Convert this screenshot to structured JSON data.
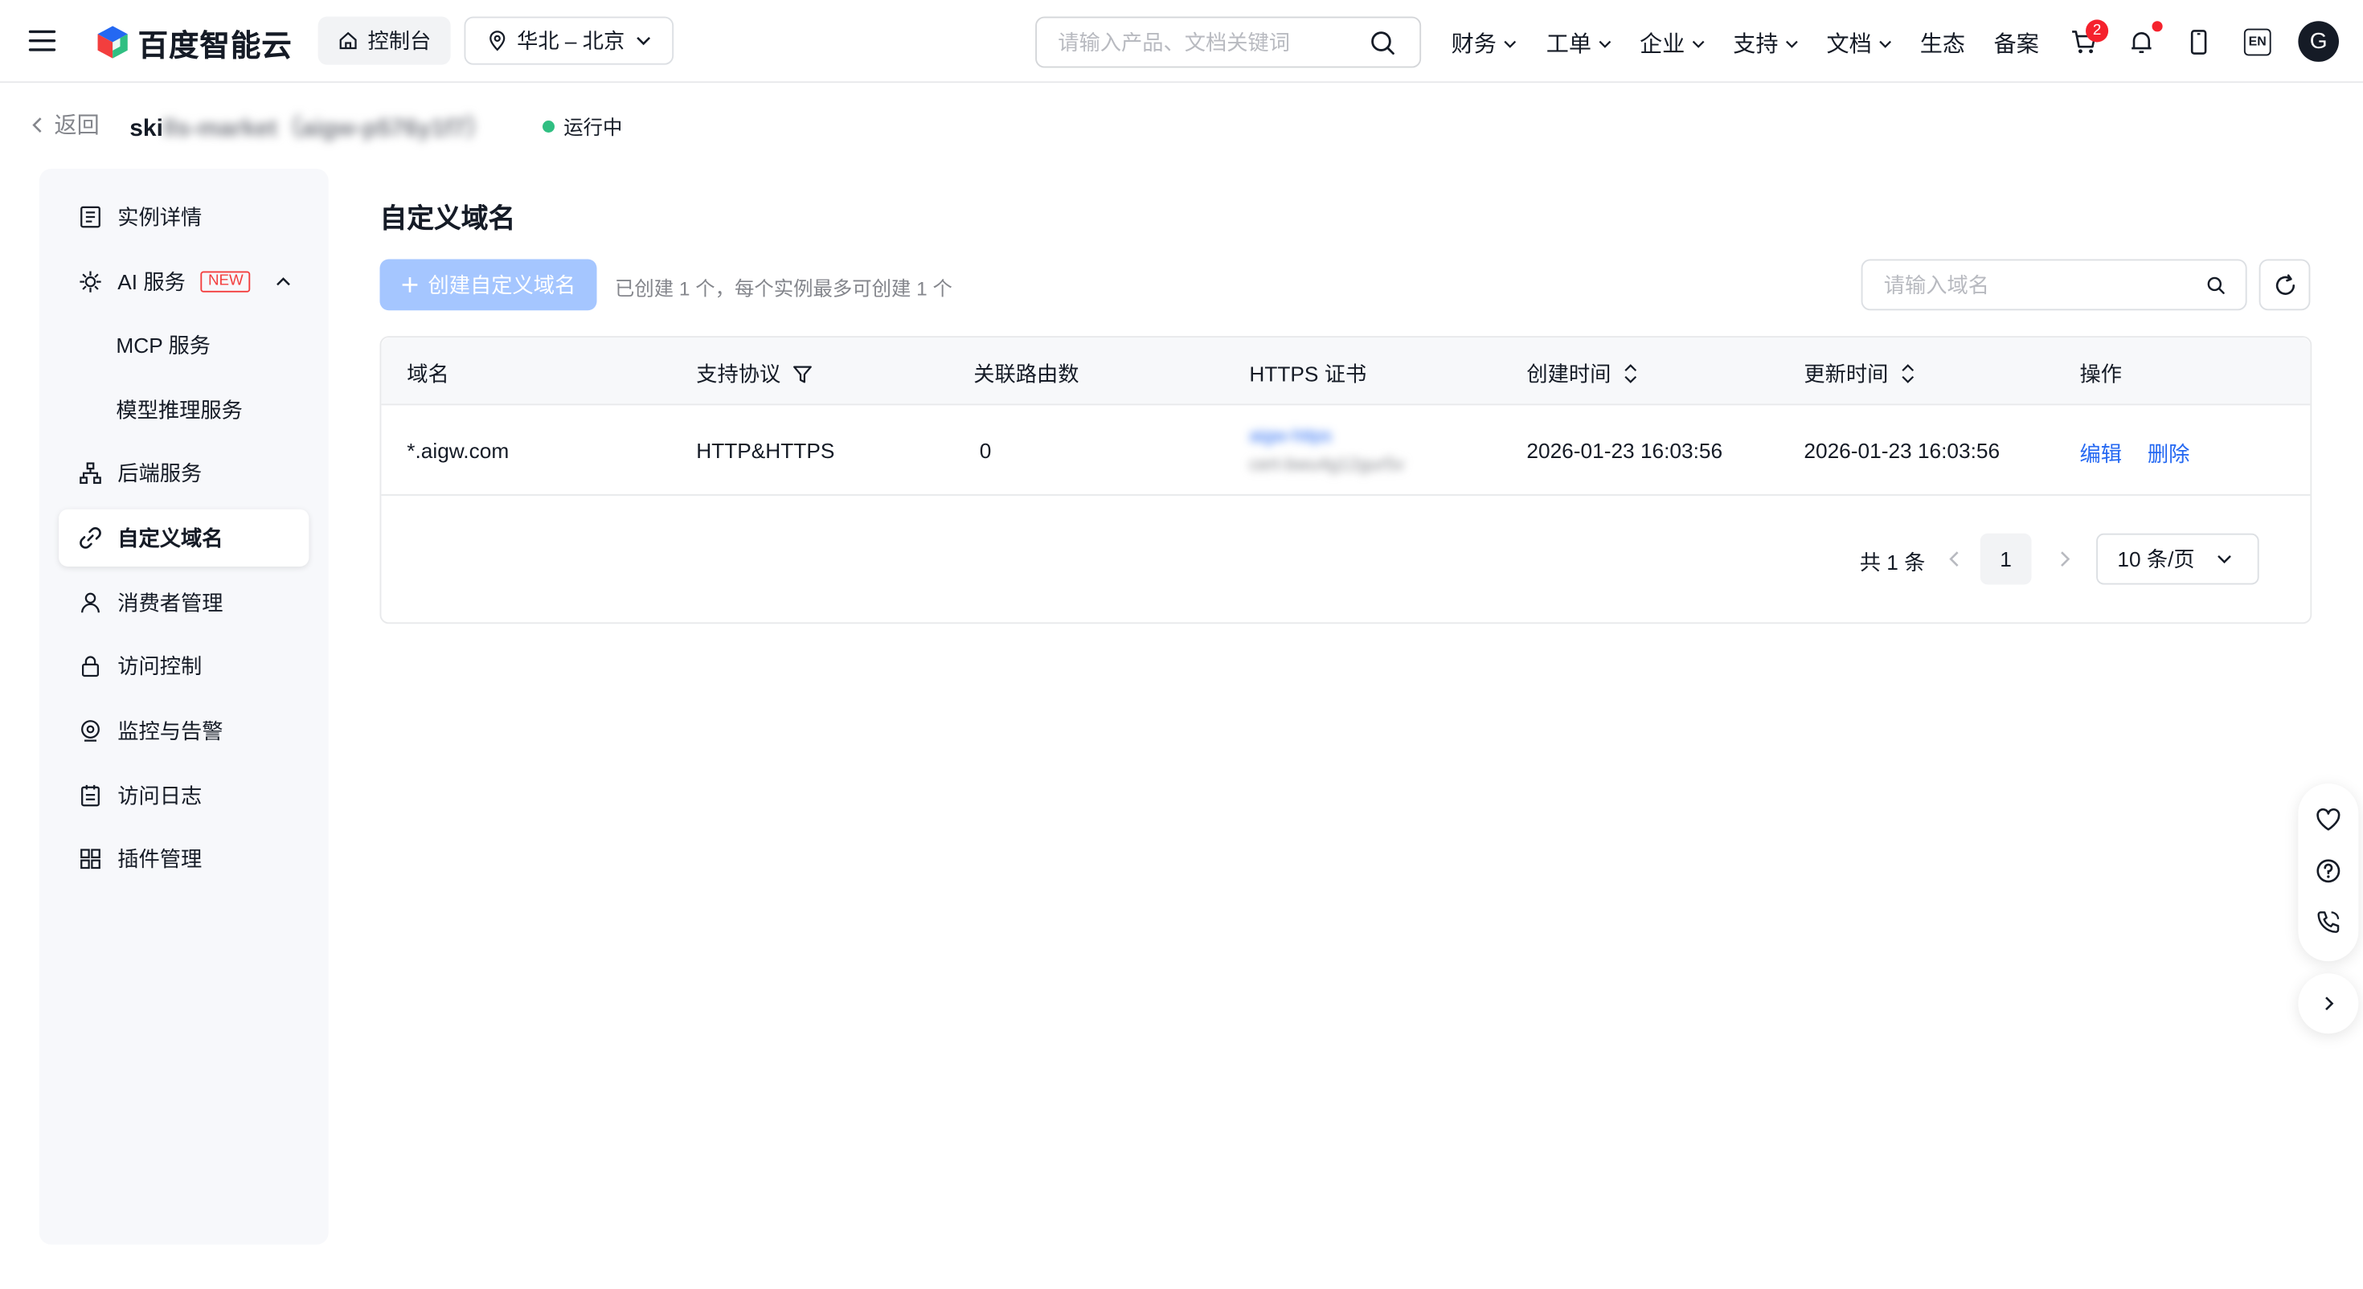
{
  "topnav": {
    "logo_text": "百度智能云",
    "console_label": "控制台",
    "region_label": "华北 – 北京",
    "search_placeholder": "请输入产品、文档关键词",
    "nav_items": [
      "财务",
      "工单",
      "企业",
      "支持",
      "文档",
      "生态",
      "备案"
    ],
    "cart_count": "2",
    "lang_label": "EN",
    "avatar_letter": "G",
    "accent_color": "#2468f2"
  },
  "header": {
    "back_label": "返回",
    "instance_name_visible": "ski",
    "instance_name_blurred": "lls-market（aigw-p576y1f7）",
    "status_label": "运行中",
    "status_color": "#30bf82"
  },
  "sidebar": {
    "items": [
      {
        "label": "实例详情",
        "icon": "detail-list-icon"
      },
      {
        "label": "AI 服务",
        "icon": "ai-service-icon",
        "badge": "NEW"
      },
      {
        "label": "MCP 服务"
      },
      {
        "label": "模型推理服务"
      },
      {
        "label": "后端服务",
        "icon": "backend-tree-icon"
      },
      {
        "label": "自定义域名",
        "icon": "link-icon",
        "active": true
      },
      {
        "label": "消费者管理",
        "icon": "user-icon"
      },
      {
        "label": "访问控制",
        "icon": "lock-icon"
      },
      {
        "label": "监控与告警",
        "icon": "monitor-icon"
      },
      {
        "label": "访问日志",
        "icon": "log-icon"
      },
      {
        "label": "插件管理",
        "icon": "plugin-grid-icon"
      }
    ]
  },
  "main": {
    "title": "自定义域名",
    "create_button": "创建自定义域名",
    "hint": "已创建 1 个，每个实例最多可创建 1 个",
    "search_placeholder": "请输入域名",
    "table": {
      "columns": [
        "域名",
        "支持协议",
        "关联路由数",
        "HTTPS 证书",
        "创建时间",
        "更新时间",
        "操作"
      ],
      "rows": [
        {
          "domain": "*.aigw.com",
          "protocol": "HTTP&HTTPS",
          "route_count": "0",
          "cert_name": "aigw-https",
          "cert_id": "cert-bwu4g12gur5v",
          "created": "2026-01-23 16:03:56",
          "updated": "2026-01-23 16:03:56",
          "edit_label": "编辑",
          "delete_label": "删除"
        }
      ]
    },
    "pager": {
      "total": "共 1 条",
      "current_page": "1",
      "page_size": "10 条/页"
    }
  }
}
